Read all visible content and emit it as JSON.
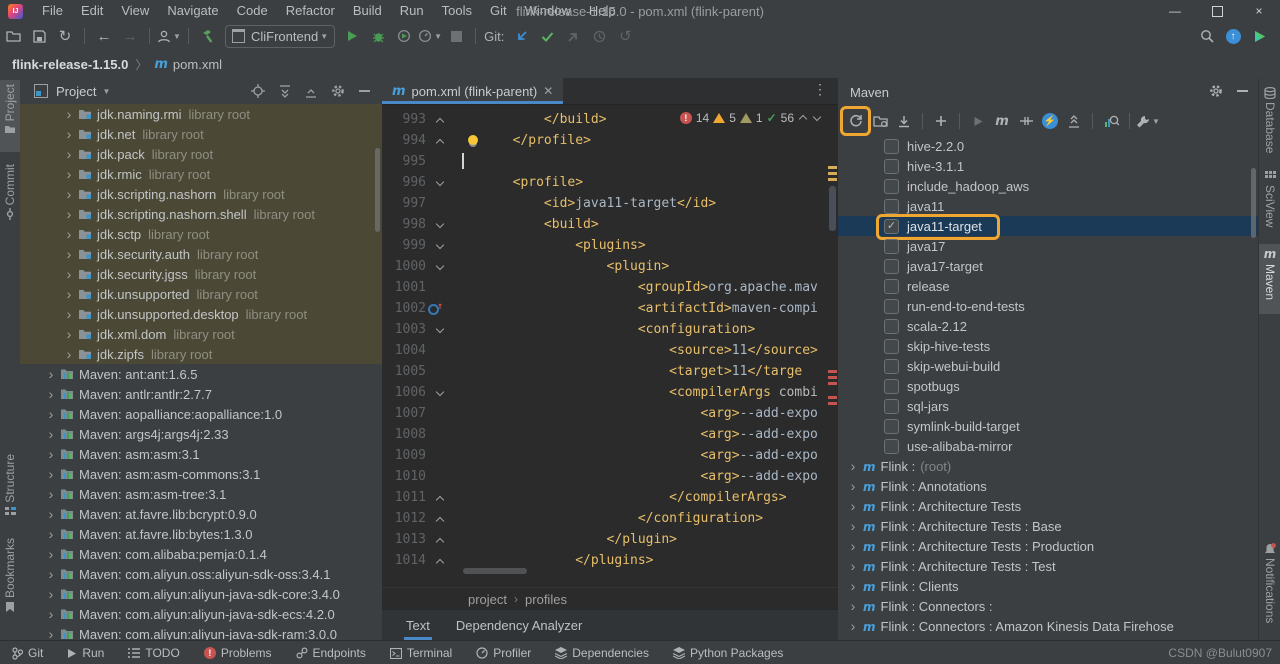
{
  "window": {
    "title": "flink-release-1.15.0 - pom.xml (flink-parent)",
    "menu": [
      "File",
      "Edit",
      "View",
      "Navigate",
      "Code",
      "Refactor",
      "Build",
      "Run",
      "Tools",
      "Git",
      "Window",
      "Help"
    ]
  },
  "toolbar": {
    "run_config": "CliFrontend",
    "git_label": "Git:"
  },
  "breadcrumb": {
    "project": "flink-release-1.15.0",
    "file": "pom.xml"
  },
  "left_strip": {
    "project": "Project",
    "commit": "Commit",
    "structure": "Structure",
    "bookmarks": "Bookmarks"
  },
  "right_strip": {
    "database": "Database",
    "sciview": "SciView",
    "maven": "Maven",
    "notifications": "Notifications"
  },
  "project_panel": {
    "title": "Project",
    "jdk_suffix": "library root",
    "jdk_items": [
      "jdk.naming.rmi",
      "jdk.net",
      "jdk.pack",
      "jdk.rmic",
      "jdk.scripting.nashorn",
      "jdk.scripting.nashorn.shell",
      "jdk.sctp",
      "jdk.security.auth",
      "jdk.security.jgss",
      "jdk.unsupported",
      "jdk.unsupported.desktop",
      "jdk.xml.dom",
      "jdk.zipfs"
    ],
    "maven_items": [
      "Maven: ant:ant:1.6.5",
      "Maven: antlr:antlr:2.7.7",
      "Maven: aopalliance:aopalliance:1.0",
      "Maven: args4j:args4j:2.33",
      "Maven: asm:asm:3.1",
      "Maven: asm:asm-commons:3.1",
      "Maven: asm:asm-tree:3.1",
      "Maven: at.favre.lib:bcrypt:0.9.0",
      "Maven: at.favre.lib:bytes:1.3.0",
      "Maven: com.alibaba:pemja:0.1.4",
      "Maven: com.aliyun.oss:aliyun-sdk-oss:3.4.1",
      "Maven: com.aliyun:aliyun-java-sdk-core:3.4.0",
      "Maven: com.aliyun:aliyun-java-sdk-ecs:4.2.0",
      "Maven: com.aliyun:aliyun-java-sdk-ram:3.0.0"
    ]
  },
  "editor": {
    "tab": "pom.xml (flink-parent)",
    "inspections": {
      "errors": "14",
      "warnings": "5",
      "weak": "1",
      "typos": "56"
    },
    "crumbs": [
      "project",
      "profiles"
    ],
    "bottom_tabs": [
      "Text",
      "Dependency Analyzer"
    ],
    "lines": [
      {
        "n": "993",
        "i": 12,
        "f": "up",
        "s": [
          [
            "t",
            "</build>"
          ]
        ]
      },
      {
        "n": "994",
        "i": 8,
        "f": "up",
        "bulb": true,
        "s": [
          [
            "t",
            "</profile>"
          ]
        ]
      },
      {
        "n": "995",
        "i": 0,
        "f": null,
        "caret": true,
        "s": []
      },
      {
        "n": "996",
        "i": 8,
        "f": "down",
        "s": [
          [
            "t",
            "<profile>"
          ]
        ]
      },
      {
        "n": "997",
        "i": 12,
        "f": null,
        "s": [
          [
            "t",
            "<id>"
          ],
          [
            "x",
            "java11-target"
          ],
          [
            "t",
            "</id>"
          ]
        ]
      },
      {
        "n": "998",
        "i": 12,
        "f": "down",
        "s": [
          [
            "t",
            "<build>"
          ]
        ]
      },
      {
        "n": "999",
        "i": 16,
        "f": "down",
        "s": [
          [
            "t",
            "<plugins>"
          ]
        ]
      },
      {
        "n": "1000",
        "i": 20,
        "f": "down",
        "s": [
          [
            "t",
            "<plugin>"
          ]
        ]
      },
      {
        "n": "1001",
        "i": 24,
        "f": null,
        "s": [
          [
            "t",
            "<groupId>"
          ],
          [
            "x",
            "org.apache.mav"
          ]
        ]
      },
      {
        "n": "1002",
        "i": 24,
        "f": null,
        "ovr": true,
        "s": [
          [
            "t",
            "<artifactId>"
          ],
          [
            "x",
            "maven-compi"
          ]
        ]
      },
      {
        "n": "1003",
        "i": 24,
        "f": "down",
        "s": [
          [
            "t",
            "<configuration>"
          ]
        ]
      },
      {
        "n": "1004",
        "i": 28,
        "f": null,
        "s": [
          [
            "t",
            "<source>"
          ],
          [
            "x",
            "11"
          ],
          [
            "t",
            "</source>"
          ]
        ]
      },
      {
        "n": "1005",
        "i": 28,
        "f": null,
        "s": [
          [
            "t",
            "<target>"
          ],
          [
            "x",
            "11"
          ],
          [
            "t",
            "</targe"
          ]
        ]
      },
      {
        "n": "1006",
        "i": 28,
        "f": "down",
        "s": [
          [
            "t",
            "<compilerArgs"
          ],
          [
            "a",
            " combi"
          ]
        ]
      },
      {
        "n": "1007",
        "i": 32,
        "f": null,
        "s": [
          [
            "t",
            "<arg>"
          ],
          [
            "x",
            "--add-expo"
          ]
        ]
      },
      {
        "n": "1008",
        "i": 32,
        "f": null,
        "s": [
          [
            "t",
            "<arg>"
          ],
          [
            "x",
            "--add-expo"
          ]
        ]
      },
      {
        "n": "1009",
        "i": 32,
        "f": null,
        "s": [
          [
            "t",
            "<arg>"
          ],
          [
            "x",
            "--add-expo"
          ]
        ]
      },
      {
        "n": "1010",
        "i": 32,
        "f": null,
        "s": [
          [
            "t",
            "<arg>"
          ],
          [
            "x",
            "--add-expo"
          ]
        ]
      },
      {
        "n": "1011",
        "i": 28,
        "f": "up",
        "s": [
          [
            "t",
            "</compilerArgs>"
          ]
        ]
      },
      {
        "n": "1012",
        "i": 24,
        "f": "up",
        "s": [
          [
            "t",
            "</configuration>"
          ]
        ]
      },
      {
        "n": "1013",
        "i": 20,
        "f": "up",
        "s": [
          [
            "t",
            "</plugin>"
          ]
        ]
      },
      {
        "n": "1014",
        "i": 16,
        "f": "up",
        "s": [
          [
            "t",
            "</plugins>"
          ]
        ]
      }
    ]
  },
  "maven_panel": {
    "title": "Maven",
    "profiles": [
      {
        "label": "hive-2.2.0",
        "checked": false
      },
      {
        "label": "hive-3.1.1",
        "checked": false
      },
      {
        "label": "include_hadoop_aws",
        "checked": false
      },
      {
        "label": "java11",
        "checked": false
      },
      {
        "label": "java11-target",
        "checked": true,
        "selected": true,
        "annotated": true
      },
      {
        "label": "java17",
        "checked": false
      },
      {
        "label": "java17-target",
        "checked": false
      },
      {
        "label": "release",
        "checked": false
      },
      {
        "label": "run-end-to-end-tests",
        "checked": false
      },
      {
        "label": "scala-2.12",
        "checked": false
      },
      {
        "label": "skip-hive-tests",
        "checked": false
      },
      {
        "label": "skip-webui-build",
        "checked": false
      },
      {
        "label": "spotbugs",
        "checked": false
      },
      {
        "label": "sql-jars",
        "checked": false
      },
      {
        "label": "symlink-build-target",
        "checked": false
      },
      {
        "label": "use-alibaba-mirror",
        "checked": false
      }
    ],
    "modules": [
      {
        "label": "Flink :",
        "dim": "(root)"
      },
      {
        "label": "Flink : Annotations",
        "dim": ""
      },
      {
        "label": "Flink : Architecture Tests",
        "dim": ""
      },
      {
        "label": "Flink : Architecture Tests : Base",
        "dim": ""
      },
      {
        "label": "Flink : Architecture Tests : Production",
        "dim": ""
      },
      {
        "label": "Flink : Architecture Tests : Test",
        "dim": ""
      },
      {
        "label": "Flink : Clients",
        "dim": ""
      },
      {
        "label": "Flink : Connectors :",
        "dim": ""
      },
      {
        "label": "Flink : Connectors : Amazon Kinesis Data Firehose",
        "dim": ""
      }
    ]
  },
  "status_bar": {
    "items": [
      "Git",
      "Run",
      "TODO",
      "Problems",
      "Endpoints",
      "Terminal",
      "Profiler",
      "Dependencies",
      "Python Packages"
    ],
    "watermark": "CSDN @Bulut0907"
  }
}
